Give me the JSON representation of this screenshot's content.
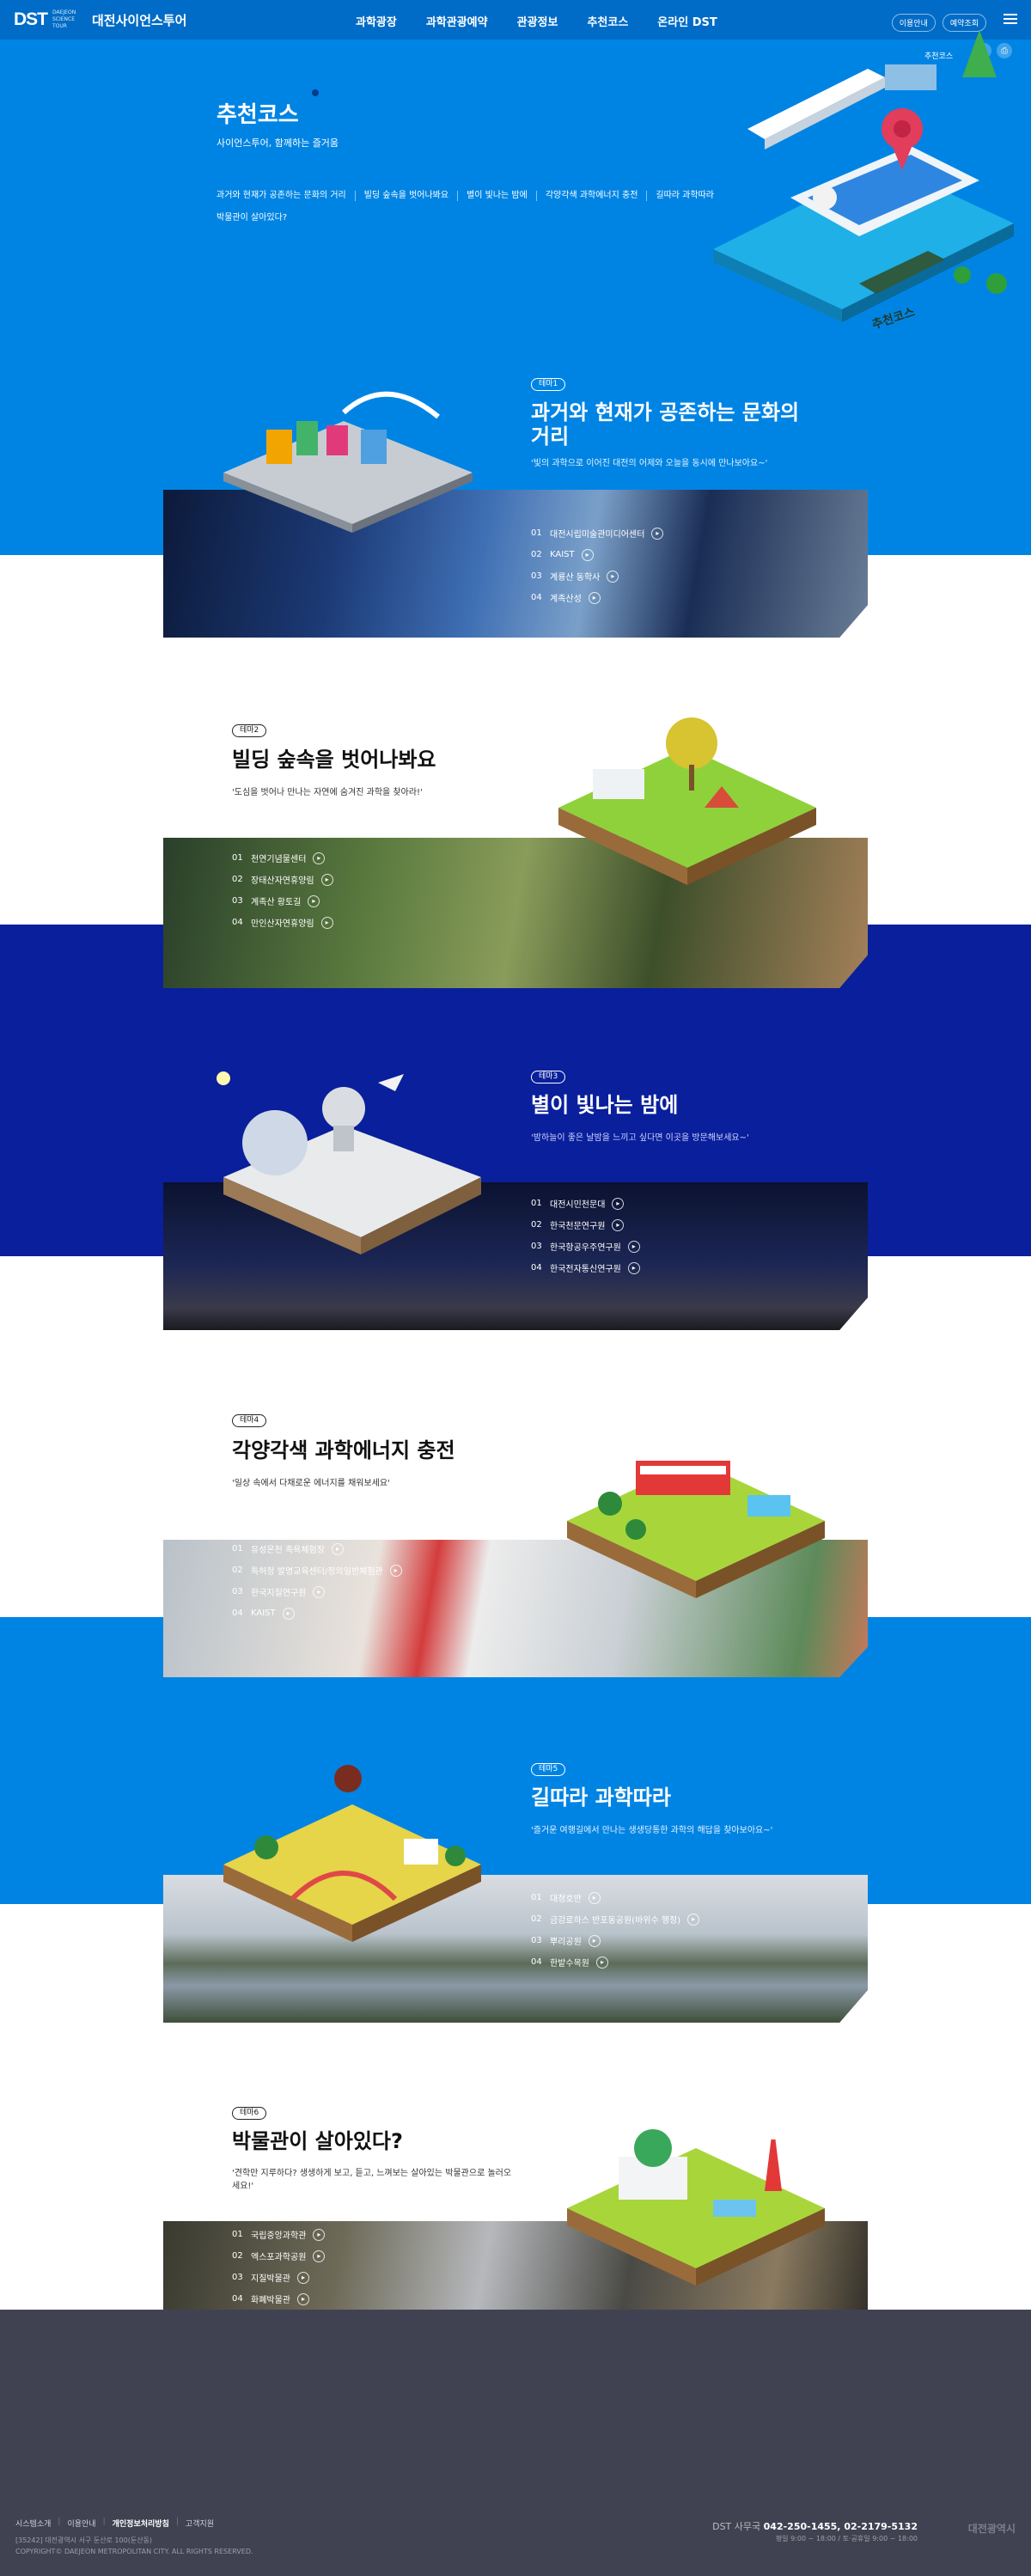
{
  "header": {
    "logo_mark": "DST",
    "logo_sub": "DAEJEON SCIENCE TOUR",
    "logo_text": "대전사이언스투어",
    "nav": [
      "과학광장",
      "과학관광예약",
      "관광정보",
      "추천코스",
      "온라인 DST"
    ],
    "util": [
      "이용안내",
      "예약조회"
    ]
  },
  "hero": {
    "title": "추천코스",
    "subtitle": "사이언스투어, 함께하는 즐거움",
    "links": [
      "과거와 현재가 공존하는 문화의 거리",
      "빌딩 숲속을 벗어나봐요",
      "별이 빛나는 밤에",
      "각양각색 과학에너지 충전",
      "길따라 과학따라",
      "박물관이 살아있다?"
    ],
    "side_label": "추천코스",
    "sign": "추천코스"
  },
  "courses": [
    {
      "badge": "테마1",
      "title": "과거와 현재가 공존하는 문화의 거리",
      "desc": "'빛의 과학으로 이어진 대전의 어제와 오늘을 동시에 만나보아요~'",
      "places": [
        {
          "num": "01",
          "name": "대전시립미술관미디어센터"
        },
        {
          "num": "02",
          "name": "KAIST"
        },
        {
          "num": "03",
          "name": "계룡산 동학사"
        },
        {
          "num": "04",
          "name": "계족산성"
        }
      ]
    },
    {
      "badge": "테마2",
      "title": "빌딩 숲속을 벗어나봐요",
      "desc": "'도심을 벗어나 만나는 자연에 숨겨진 과학을 찾아라!'",
      "places": [
        {
          "num": "01",
          "name": "천연기념물센터"
        },
        {
          "num": "02",
          "name": "장태산자연휴양림"
        },
        {
          "num": "03",
          "name": "계족산 황토길"
        },
        {
          "num": "04",
          "name": "만인산자연휴양림"
        }
      ]
    },
    {
      "badge": "테마3",
      "title": "별이 빛나는 밤에",
      "desc": "'밤하늘이 좋은 날밤을 느끼고 싶다면 이곳을 방문해보세요~'",
      "places": [
        {
          "num": "01",
          "name": "대전시민천문대"
        },
        {
          "num": "02",
          "name": "한국천문연구원"
        },
        {
          "num": "03",
          "name": "한국항공우주연구원"
        },
        {
          "num": "04",
          "name": "한국전자통신연구원"
        }
      ]
    },
    {
      "badge": "테마4",
      "title": "각양각색 과학에너지 충전",
      "desc": "'일상 속에서 다채로운 에너지를 채워보세요'",
      "places": [
        {
          "num": "01",
          "name": "유성온천 족욕체험장"
        },
        {
          "num": "02",
          "name": "특허청 발명교육센터/정의일반체험관"
        },
        {
          "num": "03",
          "name": "한국지질연구원"
        },
        {
          "num": "04",
          "name": "KAIST"
        }
      ]
    },
    {
      "badge": "테마5",
      "title": "길따라 과학따라",
      "desc": "'즐거운 여행길에서 만나는 생생당통한 과학의 해답을 찾아보아요~'",
      "places": [
        {
          "num": "01",
          "name": "대청호반"
        },
        {
          "num": "02",
          "name": "금강로하스 반포동공원(바위수 행정)"
        },
        {
          "num": "03",
          "name": "뿌리공원"
        },
        {
          "num": "04",
          "name": "한밭수목원"
        }
      ]
    },
    {
      "badge": "테마6",
      "title": "박물관이 살아있다?",
      "desc": "'견학만 지루하다? 생생하게 보고, 듣고, 느껴보는 살아있는 박물관으로 놀러오세요!'",
      "places": [
        {
          "num": "01",
          "name": "국립중앙과학관"
        },
        {
          "num": "02",
          "name": "엑스포과학공원"
        },
        {
          "num": "03",
          "name": "지질박물관"
        },
        {
          "num": "04",
          "name": "화폐박물관"
        }
      ]
    }
  ],
  "footer": {
    "links": [
      "시스템소개",
      "이용안내",
      "개인정보처리방침",
      "고객지원"
    ],
    "address": "[35242] 대전광역시 서구 둔산로 100(둔산동)",
    "copyright": "COPYRIGHT© DAEJEON METROPOLITAN CITY. ALL RIGHTS RESERVED.",
    "phone_label": "DST 사무국",
    "phone": "042-250-1455, 02-2179-5132",
    "hours": "평일 9:00 ~ 18:00 / 토·공휴일 9:00 ~ 18:00",
    "logo": "대전광역시"
  },
  "colors": {
    "header": "#006cc7",
    "blue": "#0084e4",
    "navy": "#0a1f9b",
    "footer": "#414251"
  }
}
